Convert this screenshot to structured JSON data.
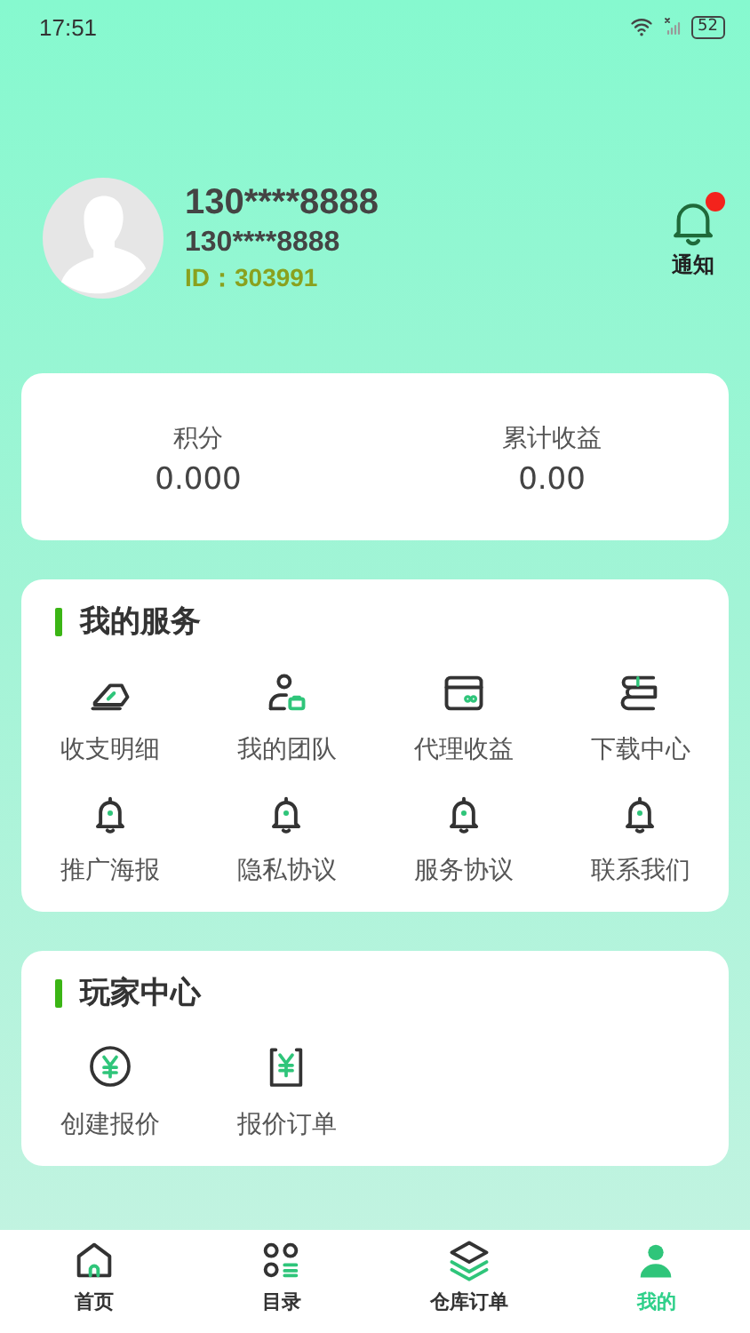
{
  "status_bar": {
    "time": "17:51",
    "battery": "52"
  },
  "profile": {
    "name": "130****8888",
    "phone": "130****8888",
    "id_label": "ID：",
    "id_value": "303991"
  },
  "notification": {
    "label": "通知",
    "unread": true
  },
  "stats": [
    {
      "label": "积分",
      "value": "0.000"
    },
    {
      "label": "累计收益",
      "value": "0.00"
    }
  ],
  "services": {
    "title": "我的服务",
    "items": [
      {
        "label": "收支明细"
      },
      {
        "label": "我的团队"
      },
      {
        "label": "代理收益"
      },
      {
        "label": "下载中心"
      },
      {
        "label": "推广海报"
      },
      {
        "label": "隐私协议"
      },
      {
        "label": "服务协议"
      },
      {
        "label": "联系我们"
      }
    ]
  },
  "player_center": {
    "title": "玩家中心",
    "items": [
      {
        "label": "创建报价"
      },
      {
        "label": "报价订单"
      }
    ]
  },
  "tab_bar": [
    {
      "label": "首页",
      "selected": false
    },
    {
      "label": "目录",
      "selected": false
    },
    {
      "label": "仓库订单",
      "selected": false
    },
    {
      "label": "我的",
      "selected": true
    }
  ]
}
